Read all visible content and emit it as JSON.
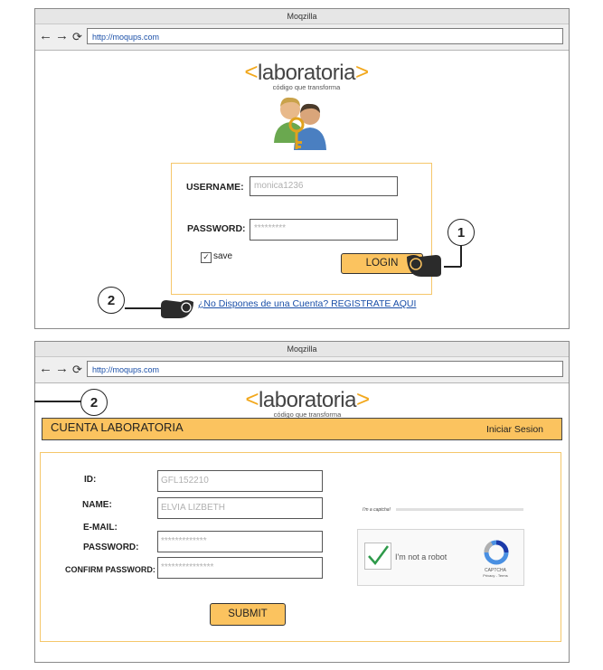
{
  "browser1": {
    "title": "Moqzilla",
    "url": "http://moqups.com",
    "logo": {
      "open": "<",
      "text": "laboratoria",
      "close": ">",
      "tagline": "código que transforma"
    },
    "login": {
      "username_label": "USERNAME:",
      "username_value": "monica1236",
      "password_label": "PASSWORD:",
      "password_value": "*********",
      "save_checked": true,
      "save_label": "save",
      "login_button": "LOGIN"
    },
    "register_link": "¿No Dispones de una Cuenta? REGISTRATE AQUI"
  },
  "callouts": {
    "one": "1",
    "two": "2"
  },
  "browser2": {
    "title": "Moqzilla",
    "url": "http://moqups.com",
    "logo": {
      "open": "<",
      "text": "laboratoria",
      "close": ">",
      "tagline": "código que transforma"
    },
    "header": {
      "title": "CUENTA LABORATORIA",
      "signin_link": "Iniciar Sesion"
    },
    "form": {
      "id_label": "ID:",
      "id_value": "GFL152210",
      "name_label": "NAME:",
      "name_value": "ELVIA LIZBETH",
      "email_label": "E-MAIL:",
      "password_label": "PASSWORD:",
      "password_value": "*************",
      "confirm_label": "CONFIRM PASSWORD:",
      "confirm_value": "***************",
      "submit_button": "SUBMIT"
    },
    "captcha": {
      "hint": "I'm a captcha!",
      "robot_label": "I'm not a robot",
      "brand": "CAPTCHA",
      "brand_sub": "Privacy - Terms"
    }
  },
  "colors": {
    "accent": "#fbc35f",
    "accent_border": "#f5c76a",
    "logo_bracket": "#f2a81d",
    "link": "#1a4fa8"
  },
  "icons": [
    "back-arrow-icon",
    "forward-arrow-icon",
    "refresh-icon",
    "users-key-icon",
    "pointing-hand-icon",
    "checkmark-icon",
    "recaptcha-logo-icon"
  ]
}
